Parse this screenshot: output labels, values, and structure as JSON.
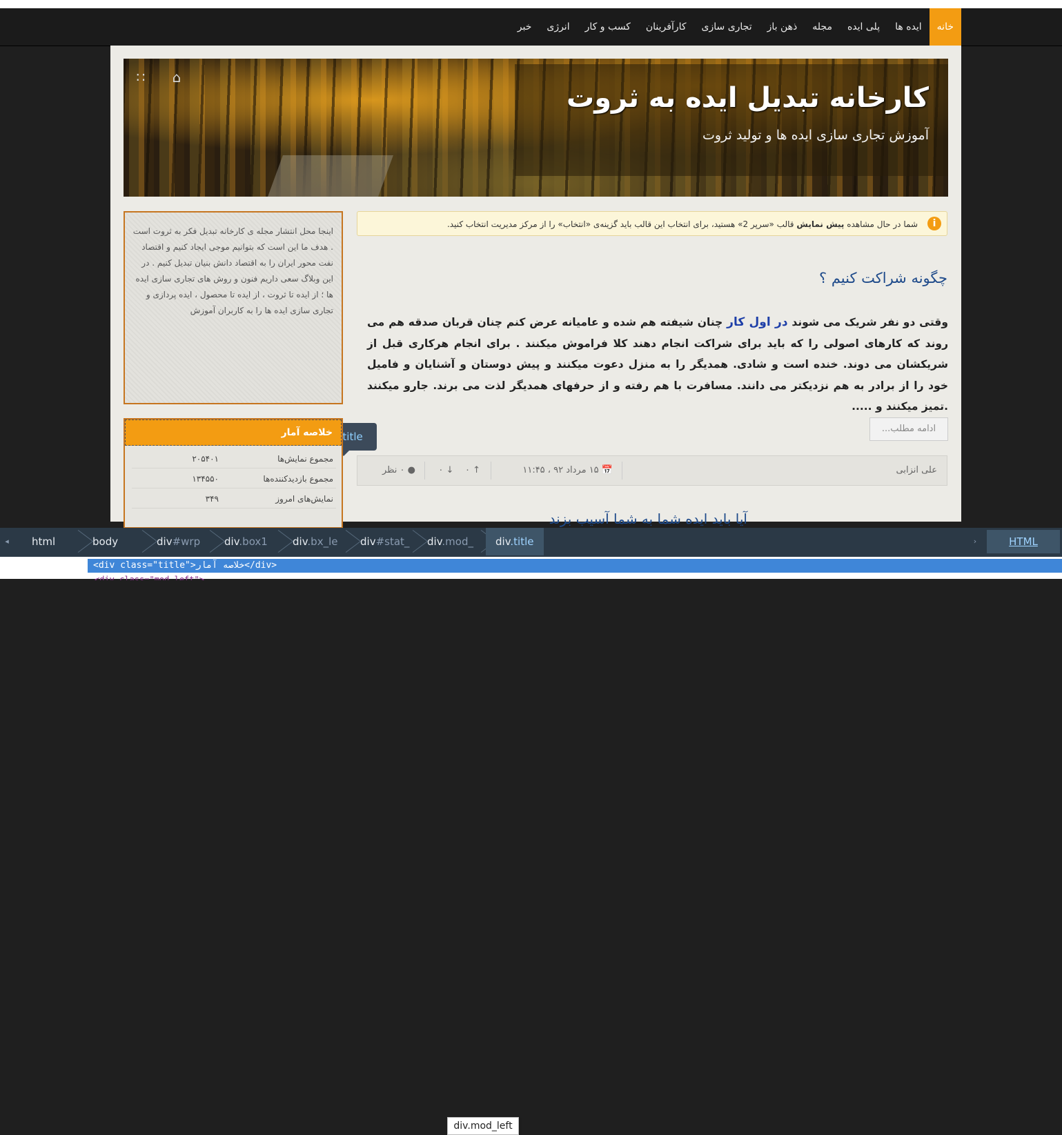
{
  "nav": {
    "items": [
      "خانه",
      "ایده ها",
      "پلی ایده",
      "مجله",
      "ذهن باز",
      "تجاری سازی",
      "کارآفرینان",
      "کسب و کار",
      "انرژی",
      "خبر"
    ],
    "active_index": 0
  },
  "header": {
    "title": "کارخانه تبدیل ایده به ثروت",
    "subtitle": "آموزش تجاری سازی ایده ها و تولید ثروت",
    "icons": [
      "home-icon",
      "rss-icon"
    ]
  },
  "notice": {
    "text_before": "شما در حال مشاهده",
    "text_bold": "پیش نمایش",
    "text_after": "قالب «سرپر 2» هستید، برای انتخاب این قالب باید گزینه‌ی «انتخاب» را از مرکز مدیریت انتخاب کنید."
  },
  "post": {
    "title": "چگونه شراکت کنیم ؟",
    "body_start": "وقتی دو نفر شریک می شوند",
    "link_text": "در اول کار",
    "body_rest": "چنان شیفته هم شده و عامیانه عرض کنم چنان قربان صدقه هم می روند که کارهای اصولی را که باید برای شراکت انجام دهند کلا فراموش میکنند . برای انجام هرکاری قبل از شریکشان می دوند. خنده است و شادی. همدیگر را به منزل دعوت میکنند و پیش دوستان و آشنایان و فامیل خود را از برادر به هم نزدیکتر می دانند. مسافرت با هم رفته و از حرفهای همدیگر لذت می برند. جارو میکنند .تمیز میکنند و .....",
    "more_label": "ادامه مطلب...",
    "author": "علی انزابی",
    "date": "۱۵ مرداد ۹۲ ، ۱۱:۴۵",
    "votes_up": "۰",
    "votes_down": "۰",
    "comments": "۰ نظر"
  },
  "next_post": {
    "title": "آیا باید ایده شما به شما آسیب بزند"
  },
  "sidebar": {
    "about_text": "اینجا محل انتشار مجله ی کارخانه تبدیل فکر به ثروت است . هدف ما این است که بتوانیم موجی ایجاد کنیم و اقتصاد نفت محور ایران را به اقتصاد دانش بنیان تبدیل کنیم . در این وبلاگ سعی داریم فنون و روش های تجاری سازی ایده ها ؛ از ایده تا ثروت ، از ایده تا محصول ، ایده پردازی و تجاری سازی ایده ها را به کاربران آموزش",
    "stats_title": "خلاصه آمار",
    "stats": [
      {
        "label": "مجموع نمایش‌ها",
        "value": "۲۰۵۴۰۱"
      },
      {
        "label": "مجموع بازدیدکننده‌ها",
        "value": "۱۳۴۵۵۰"
      },
      {
        "label": "نمایش‌های امروز",
        "value": "۳۴۹"
      }
    ]
  },
  "tooltip": {
    "tag": "div",
    "cls": ".title"
  },
  "devtools": {
    "crumbs": [
      {
        "tag": "html",
        "cls": ""
      },
      {
        "tag": "body",
        "cls": ""
      },
      {
        "tag": "div",
        "cls": "#wrp"
      },
      {
        "tag": "div",
        "cls": ".box1"
      },
      {
        "tag": "div",
        "cls": ".bx_le"
      },
      {
        "tag": "div",
        "cls": "#stat_"
      },
      {
        "tag": "div",
        "cls": ".mod_"
      },
      {
        "tag": "div",
        "cls": ".title"
      }
    ],
    "html_tab": "HTML",
    "code_line": "<div class=\"title\">خلاصه آمار</div>",
    "code_line2": "<div class=\"mod_left\">",
    "hover_tip": "div.mod_left"
  },
  "colors": {
    "accent": "#f39c12",
    "link": "#1e4a8a",
    "devtools_bg": "#2b3946"
  }
}
